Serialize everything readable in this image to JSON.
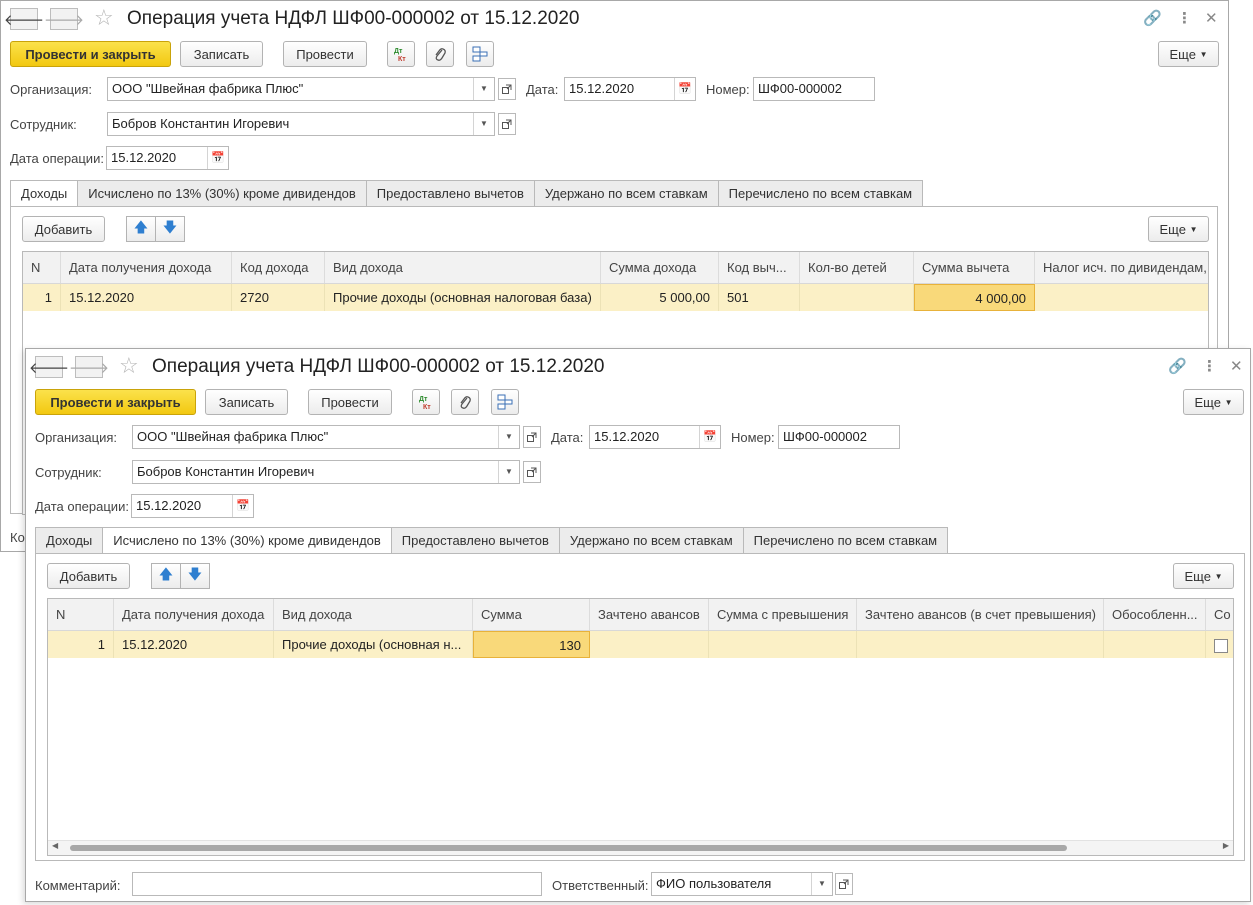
{
  "doc": {
    "title": "Операция учета НДФЛ ШФ00-000002 от 15.12.2020",
    "toolbar": {
      "post_close": "Провести и закрыть",
      "save": "Записать",
      "post": "Провести",
      "more": "Еще"
    },
    "org_label": "Организация:",
    "org_value": "ООО \"Швейная фабрика Плюс\"",
    "date_label": "Дата:",
    "date_value": "15.12.2020",
    "number_label": "Номер:",
    "number_value": "ШФ00-000002",
    "employee_label": "Сотрудник:",
    "employee_value": "Бобров Константин Игоревич",
    "op_date_label": "Дата операции:",
    "op_date_value": "15.12.2020",
    "tabs": [
      "Доходы",
      "Исчислено по 13% (30%) кроме дивидендов",
      "Предоставлено вычетов",
      "Удержано по всем ставкам",
      "Перечислено по всем ставкам"
    ],
    "add": "Добавить",
    "more": "Еще"
  },
  "win1": {
    "grid": {
      "headers": [
        "N",
        "Дата получения дохода",
        "Код дохода",
        "Вид дохода",
        "Сумма дохода",
        "Код выч...",
        "Кол-во детей",
        "Сумма вычета",
        "Налог исч. по дивидендам,"
      ],
      "row": [
        "1",
        "15.12.2020",
        "2720",
        "Прочие доходы (основная налоговая база)",
        "5 000,00",
        "501",
        "",
        "4 000,00",
        ""
      ]
    },
    "comment_stub": "Ко"
  },
  "win2": {
    "grid": {
      "headers": [
        "N",
        "Дата получения дохода",
        "Вид дохода",
        "Сумма",
        "Зачтено авансов",
        "Сумма с превышения",
        "Зачтено авансов (в счет превышения)",
        "Обособленн...",
        "Со"
      ],
      "row": [
        "1",
        "15.12.2020",
        "Прочие доходы (основная н...",
        "130",
        "",
        "",
        "",
        ""
      ]
    },
    "comment_label": "Комментарий:",
    "comment_value": "",
    "responsible_label": "Ответственный:",
    "responsible_value": "ФИО пользователя"
  }
}
